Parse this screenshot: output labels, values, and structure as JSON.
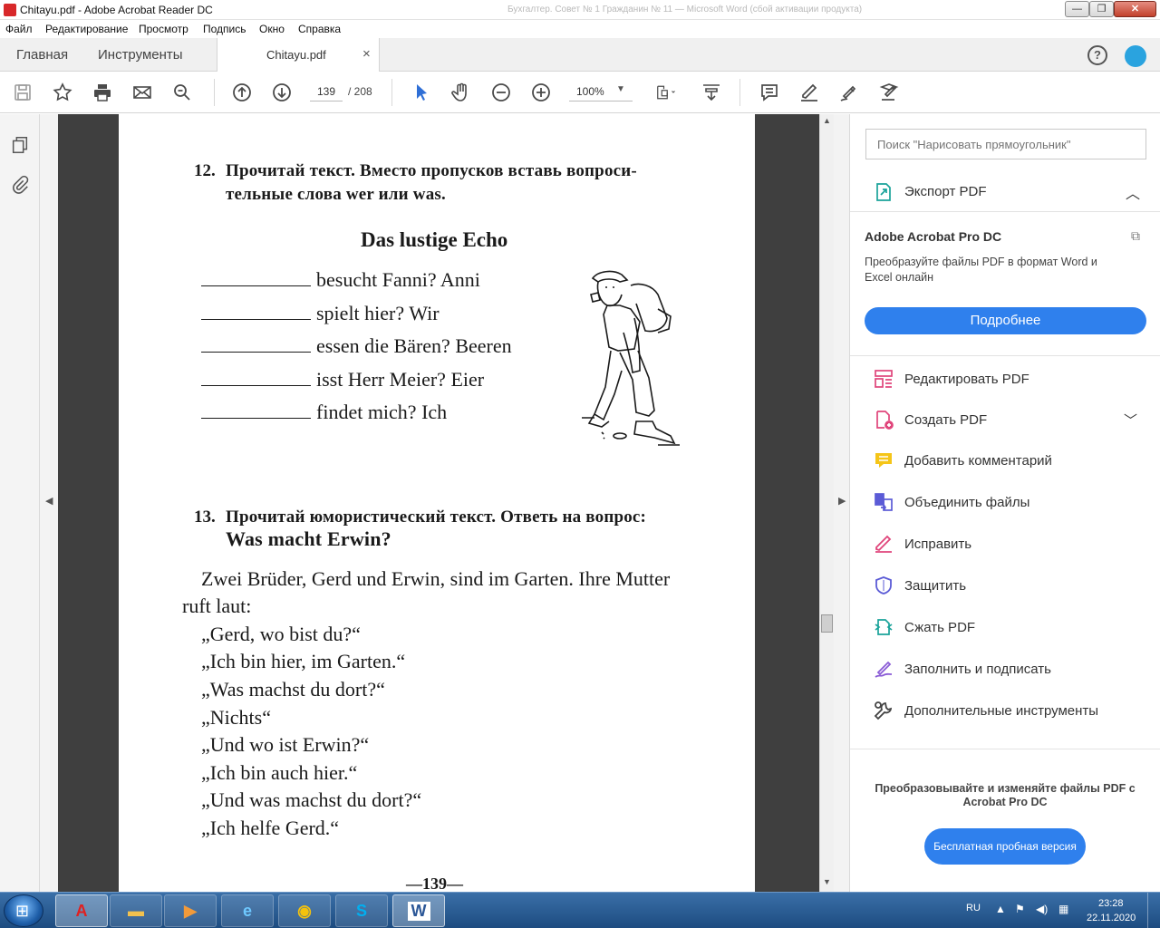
{
  "window": {
    "title": "Chitayu.pdf - Adobe Acrobat Reader DC",
    "ghost_title": "Бухгалтер. Совет № 1 Гражданин № 11 — Microsoft Word (сбой активации продукта)",
    "min": "—",
    "max": "❐",
    "close": "✕"
  },
  "menu": [
    "Файл",
    "Редактирование",
    "Просмотр",
    "Подпись",
    "Окно",
    "Справка"
  ],
  "tabs": {
    "home": "Главная",
    "tools": "Инструменты",
    "document": "Chitayu.pdf",
    "close": "×",
    "help": "?"
  },
  "toolbar": {
    "page_current": "139",
    "page_total": "/ 208",
    "zoom": "100%"
  },
  "document": {
    "task12_number": "12.",
    "task12_line1": "Прочитай текст. Вместо пропусков вставь вопроси-",
    "task12_line2": "тельные слова wer или was.",
    "echo_title": "Das lustige Echo",
    "echo_lines": [
      "besucht Fanni? Anni",
      "spielt hier? Wir",
      "essen die Bären? Beeren",
      "isst Herr Meier? Eier",
      "findet mich? Ich"
    ],
    "task13_number": "13.",
    "task13_line1": "Прочитай юмористический текст. Ответь на вопрос:",
    "task13_line2": "Was macht Erwin?",
    "story": [
      "Zwei Brüder, Gerd und Erwin, sind im Garten. Ihre Mutter",
      "ruft laut:",
      "„Gerd, wo bist du?“",
      "„Ich bin hier, im Garten.“",
      "„Was machst du dort?“",
      "„Nichts“",
      "„Und wo ist Erwin?“",
      "„Ich bin auch hier.“",
      "„Und was machst du dort?“",
      "„Ich helfe Gerd.“"
    ],
    "page_number": "—139—"
  },
  "right_panel": {
    "search_placeholder": "Поиск \"Нарисовать прямоугольник\"",
    "export_label": "Экспорт PDF",
    "promo_title": "Adobe Acrobat Pro DC",
    "promo_text": "Преобразуйте файлы PDF в формат Word и Excel онлайн",
    "more_button": "Подробнее",
    "tools": [
      {
        "label": "Редактировать PDF",
        "icon": "edit-pdf-icon",
        "color": "#e0457b"
      },
      {
        "label": "Создать PDF",
        "icon": "create-pdf-icon",
        "color": "#e0457b"
      },
      {
        "label": "Добавить комментарий",
        "icon": "comment-icon",
        "color": "#f5c518"
      },
      {
        "label": "Объединить файлы",
        "icon": "combine-files-icon",
        "color": "#5b5bd6"
      },
      {
        "label": "Исправить",
        "icon": "fix-icon",
        "color": "#e0457b"
      },
      {
        "label": "Защитить",
        "icon": "protect-icon",
        "color": "#5b5bd6"
      },
      {
        "label": "Сжать PDF",
        "icon": "compress-icon",
        "color": "#1aa39a"
      },
      {
        "label": "Заполнить и подписать",
        "icon": "fill-sign-icon",
        "color": "#8a5bd6"
      },
      {
        "label": "Дополнительные инструменты",
        "icon": "more-tools-icon",
        "color": "#444444"
      }
    ],
    "convert_text": "Преобразовывайте и изменяйте файлы PDF с Acrobat Pro DC",
    "trial_button": "Бесплатная пробная версия"
  },
  "taskbar": {
    "lang": "RU",
    "time": "23:28",
    "date": "22.11.2020"
  },
  "colors": {
    "accent": "#2f80ed",
    "doc_background": "#3f3f3f",
    "taskbar": "#1d4c80"
  }
}
